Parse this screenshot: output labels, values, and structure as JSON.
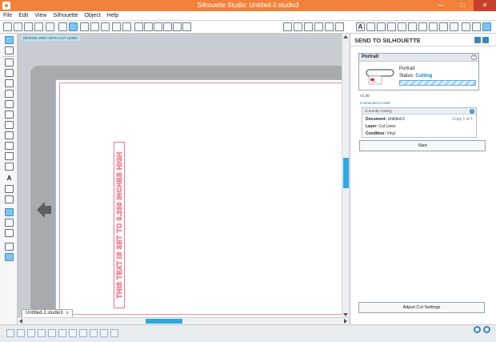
{
  "window": {
    "title": "Silhouette Studio: Untitled-2.studio3",
    "minimize": "—",
    "maximize": "□",
    "close": "✕"
  },
  "menu": [
    "File",
    "Edit",
    "View",
    "Silhouette",
    "Object",
    "Help"
  ],
  "workspace": {
    "hint": "DESIGN AREA WITH CUT LINES",
    "rotated_text": "THIS TEXT IS SET TO 0.250 INCHES HIGH",
    "doc_tab": "Untitled-2.studio3",
    "doc_tab_close": "x"
  },
  "left_tools": {
    "text_tool": "A"
  },
  "toolbar": {
    "text_tool": "A"
  },
  "panel": {
    "title": "SEND TO SILHOUETTE",
    "device": {
      "tab": "Portrait",
      "name": "Portrait",
      "status_label": "Status:",
      "status_value": "Cutting"
    },
    "version": "V1.00",
    "connected": "Connected to USB",
    "job": {
      "header": "Currently Cutting",
      "document_label": "Document:",
      "document": "Untitled-2",
      "copy": "Copy 1 of 1",
      "layer_label": "Layer:",
      "layer": "Cut Lines",
      "condition_label": "Condition:",
      "condition": "Vinyl"
    },
    "start": "Start",
    "adjust": "Adjust Cut Settings"
  },
  "colors": {
    "titlebar": "#f0823d",
    "accent": "#2fa8dd",
    "cutline": "#e9748c"
  }
}
